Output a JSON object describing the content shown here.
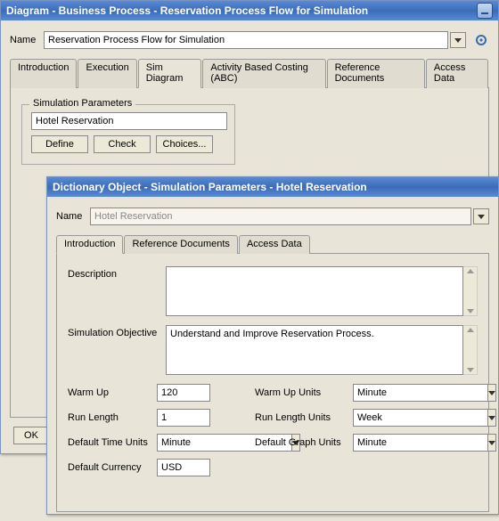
{
  "win1": {
    "title": "Diagram - Business Process - Reservation Process Flow for Simulation",
    "name_label": "Name",
    "name_value": "Reservation Process Flow for Simulation",
    "tabs": [
      "Introduction",
      "Execution",
      "Sim Diagram",
      "Activity Based Costing (ABC)",
      "Reference Documents",
      "Access Data"
    ],
    "active_tab": 2,
    "sim_params_legend": "Simulation Parameters",
    "sim_params_value": "Hotel Reservation",
    "buttons": {
      "define": "Define",
      "check": "Check",
      "choices": "Choices..."
    },
    "ok": "OK"
  },
  "win2": {
    "title": "Dictionary Object - Simulation Parameters - Hotel Reservation",
    "name_label": "Name",
    "name_value": "Hotel Reservation",
    "tabs": [
      "Introduction",
      "Reference Documents",
      "Access Data"
    ],
    "active_tab": 0,
    "description_label": "Description",
    "description_value": "",
    "objective_label": "Simulation Objective",
    "objective_value": "Understand and Improve Reservation Process.",
    "params": {
      "warm_up_label": "Warm Up",
      "warm_up_value": "120",
      "warm_up_units_label": "Warm Up Units",
      "warm_up_units_value": "Minute",
      "run_length_label": "Run Length",
      "run_length_value": "1",
      "run_length_units_label": "Run Length Units",
      "run_length_units_value": "Week",
      "default_time_units_label": "Default Time Units",
      "default_time_units_value": "Minute",
      "default_graph_units_label": "Default Graph Units",
      "default_graph_units_value": "Minute",
      "default_currency_label": "Default Currency",
      "default_currency_value": "USD"
    }
  }
}
